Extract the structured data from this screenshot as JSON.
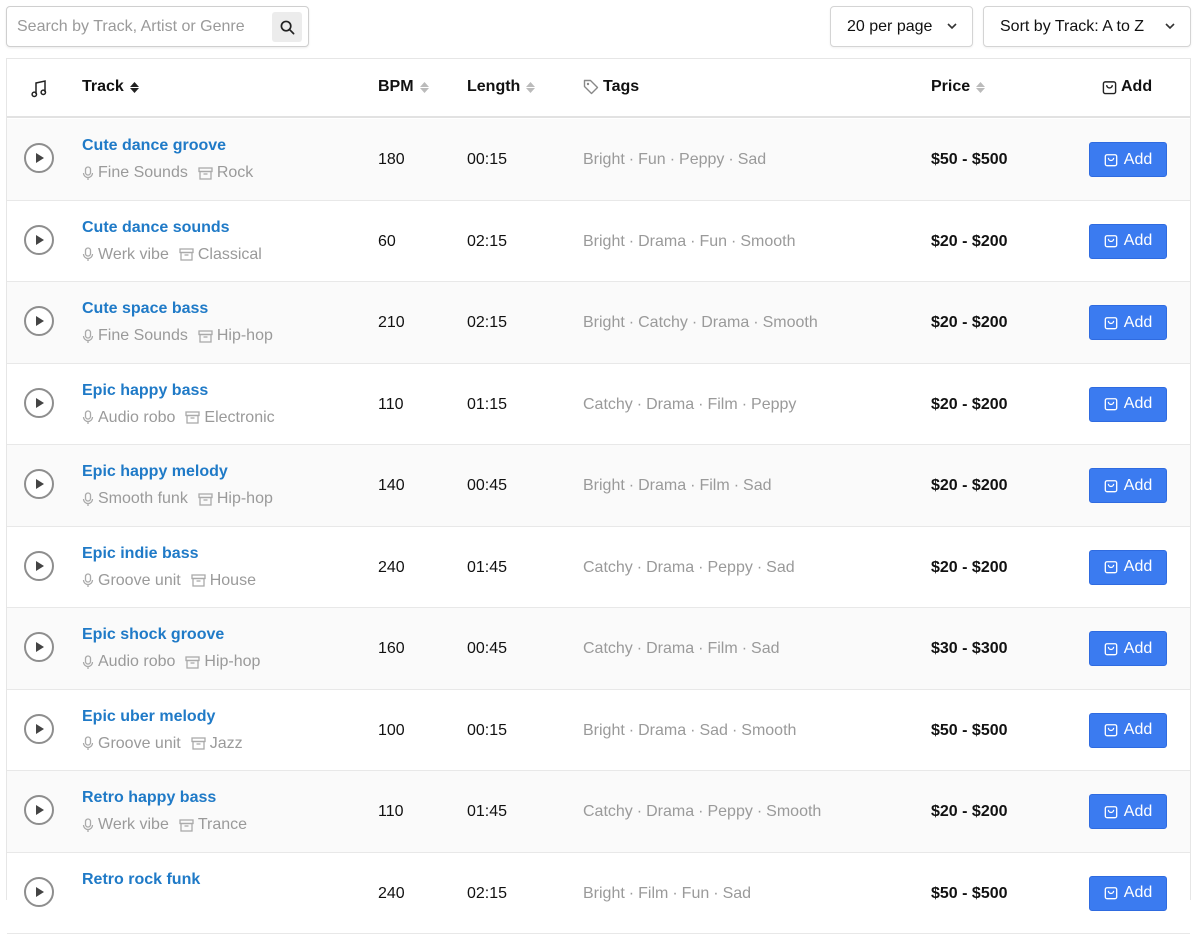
{
  "search": {
    "placeholder": "Search by Track, Artist or Genre",
    "value": ""
  },
  "per_page": {
    "label": "20 per page"
  },
  "sort": {
    "label": "Sort by Track: A to Z"
  },
  "headers": {
    "track": "Track",
    "bpm": "BPM",
    "length": "Length",
    "tags": "Tags",
    "price": "Price",
    "add": "Add"
  },
  "add_label": "Add",
  "colors": {
    "accent": "#3b7bf0",
    "link": "#1f7ac7",
    "muted": "#9a9a9a"
  },
  "tracks": [
    {
      "title": "Cute dance groove",
      "artist": "Fine Sounds",
      "genre": "Rock",
      "bpm": "180",
      "length": "00:15",
      "tags": [
        "Bright",
        "Fun",
        "Peppy",
        "Sad"
      ],
      "price": "$50 - $500"
    },
    {
      "title": "Cute dance sounds",
      "artist": "Werk vibe",
      "genre": "Classical",
      "bpm": "60",
      "length": "02:15",
      "tags": [
        "Bright",
        "Drama",
        "Fun",
        "Smooth"
      ],
      "price": "$20 - $200"
    },
    {
      "title": "Cute space bass",
      "artist": "Fine Sounds",
      "genre": "Hip-hop",
      "bpm": "210",
      "length": "02:15",
      "tags": [
        "Bright",
        "Catchy",
        "Drama",
        "Smooth"
      ],
      "price": "$20 - $200"
    },
    {
      "title": "Epic happy bass",
      "artist": "Audio robo",
      "genre": "Electronic",
      "bpm": "110",
      "length": "01:15",
      "tags": [
        "Catchy",
        "Drama",
        "Film",
        "Peppy"
      ],
      "price": "$20 - $200"
    },
    {
      "title": "Epic happy melody",
      "artist": "Smooth funk",
      "genre": "Hip-hop",
      "bpm": "140",
      "length": "00:45",
      "tags": [
        "Bright",
        "Drama",
        "Film",
        "Sad"
      ],
      "price": "$20 - $200"
    },
    {
      "title": "Epic indie bass",
      "artist": "Groove unit",
      "genre": "House",
      "bpm": "240",
      "length": "01:45",
      "tags": [
        "Catchy",
        "Drama",
        "Peppy",
        "Sad"
      ],
      "price": "$20 - $200"
    },
    {
      "title": "Epic shock groove",
      "artist": "Audio robo",
      "genre": "Hip-hop",
      "bpm": "160",
      "length": "00:45",
      "tags": [
        "Catchy",
        "Drama",
        "Film",
        "Sad"
      ],
      "price": "$30 - $300"
    },
    {
      "title": "Epic uber melody",
      "artist": "Groove unit",
      "genre": "Jazz",
      "bpm": "100",
      "length": "00:15",
      "tags": [
        "Bright",
        "Drama",
        "Sad",
        "Smooth"
      ],
      "price": "$50 - $500"
    },
    {
      "title": "Retro happy bass",
      "artist": "Werk vibe",
      "genre": "Trance",
      "bpm": "110",
      "length": "01:45",
      "tags": [
        "Catchy",
        "Drama",
        "Peppy",
        "Smooth"
      ],
      "price": "$20 - $200"
    },
    {
      "title": "Retro rock funk",
      "artist": "",
      "genre": "",
      "bpm": "240",
      "length": "02:15",
      "tags": [
        "Bright",
        "Film",
        "Fun",
        "Sad"
      ],
      "price": "$50 - $500"
    }
  ]
}
